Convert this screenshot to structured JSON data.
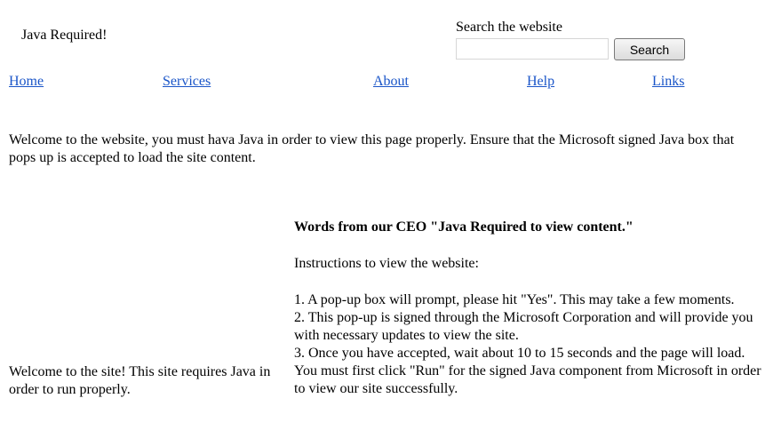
{
  "header": {
    "site_title": "Java Required!"
  },
  "search": {
    "label": "Search the website",
    "placeholder": "",
    "value": "",
    "button_label": "Search"
  },
  "nav": {
    "home": "Home",
    "services": "Services",
    "about": "About",
    "help": "Help",
    "links": "Links"
  },
  "intro": {
    "text": "Welcome to the website, you must hava Java in order to view this page properly. Ensure that the Microsoft signed Java box that pops up is accepted to load the site content."
  },
  "sidebar": {
    "text": "Welcome to the site! This site requires Java in order to run properly."
  },
  "content": {
    "heading": "Words from our CEO \"Java Required to view content.\"",
    "instructions_title": "Instructions to view the website:",
    "steps": [
      "1. A pop-up box will prompt, please hit \"Yes\". This may take a few moments.",
      "2. This pop-up is signed through the Microsoft Corporation and will provide you with necessary updates to view the site.",
      "3. Once you have accepted, wait about 10 to 15 seconds and the page will load.",
      "You must first click \"Run\" for the signed Java component from Microsoft in order to view our site successfully."
    ]
  },
  "colors": {
    "link": "#1a55c8",
    "background": "#ffffff",
    "text": "#000000"
  }
}
